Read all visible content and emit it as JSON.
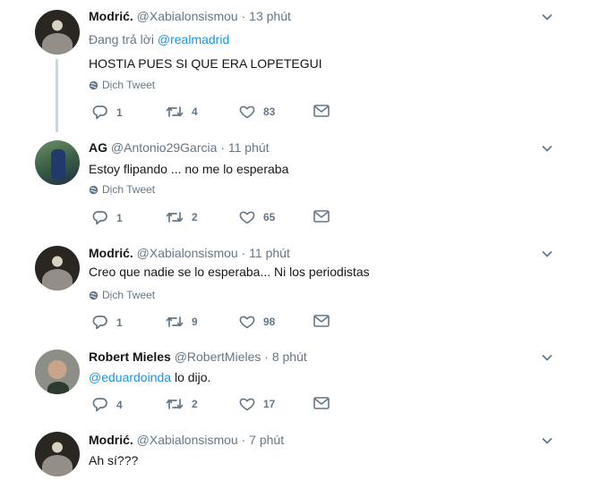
{
  "translate_label": "Dịch Tweet",
  "reply_prefix": "Đang trả lời",
  "tweets": [
    {
      "name": "Modrić.",
      "handle": "@Xabialonsismou",
      "sep": "·",
      "time": "13 phút",
      "reply_to": "@realmadrid",
      "text": "HOSTIA PUES SI QUE ERA LOPETEGUI",
      "replies": "1",
      "retweets": "4",
      "likes": "83"
    },
    {
      "name": "AG",
      "handle": "@Antonio29Garcia",
      "sep": "·",
      "time": "11 phút",
      "text": "Estoy flipando ... no me lo esperaba",
      "replies": "1",
      "retweets": "2",
      "likes": "65"
    },
    {
      "name": "Modrić.",
      "handle": "@Xabialonsismou",
      "sep": "·",
      "time": "11 phút",
      "text": "Creo que nadie se lo esperaba... Ni los periodistas",
      "replies": "1",
      "retweets": "9",
      "likes": "98"
    },
    {
      "name": "Robert Mieles",
      "handle": "@RobertMieles",
      "sep": "·",
      "time": "8 phút",
      "mention": "@eduardoinda",
      "text_after": " lo dijo.",
      "replies": "4",
      "retweets": "2",
      "likes": "17"
    },
    {
      "name": "Modrić.",
      "handle": "@Xabialonsismou",
      "sep": "·",
      "time": "7 phút",
      "text": "Ah sí???"
    }
  ],
  "colors": {
    "link": "#1b95e0",
    "secondary": "#657786",
    "thread": "#ccd6dd"
  },
  "icons": [
    "globe-icon",
    "reply-icon",
    "retweet-icon",
    "like-icon",
    "message-icon",
    "chevron-down-icon"
  ]
}
